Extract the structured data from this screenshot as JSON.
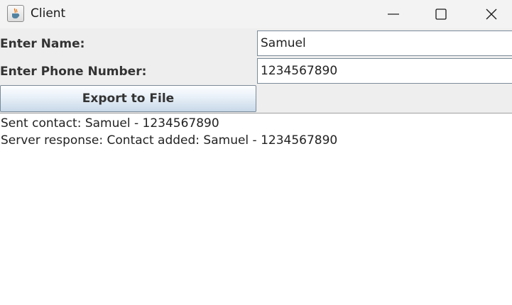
{
  "window": {
    "title": "Client",
    "icon": "java-coffee-icon",
    "controls": {
      "minimize": "minimize-icon",
      "maximize": "maximize-icon",
      "close": "close-icon"
    }
  },
  "form": {
    "name_label": "Enter Name:",
    "name_value": "Samuel",
    "phone_label": "Enter Phone Number:",
    "phone_value": "1234567890",
    "export_label": "Export to File"
  },
  "output": {
    "lines": [
      "Sent contact: Samuel - 1234567890",
      "Server response: Contact added: Samuel - 1234567890"
    ]
  },
  "colors": {
    "titlebar_bg": "#f3f3f3",
    "panel_bg": "#eeeeee",
    "output_bg": "#ffffff",
    "button_border": "#7a8a99"
  }
}
